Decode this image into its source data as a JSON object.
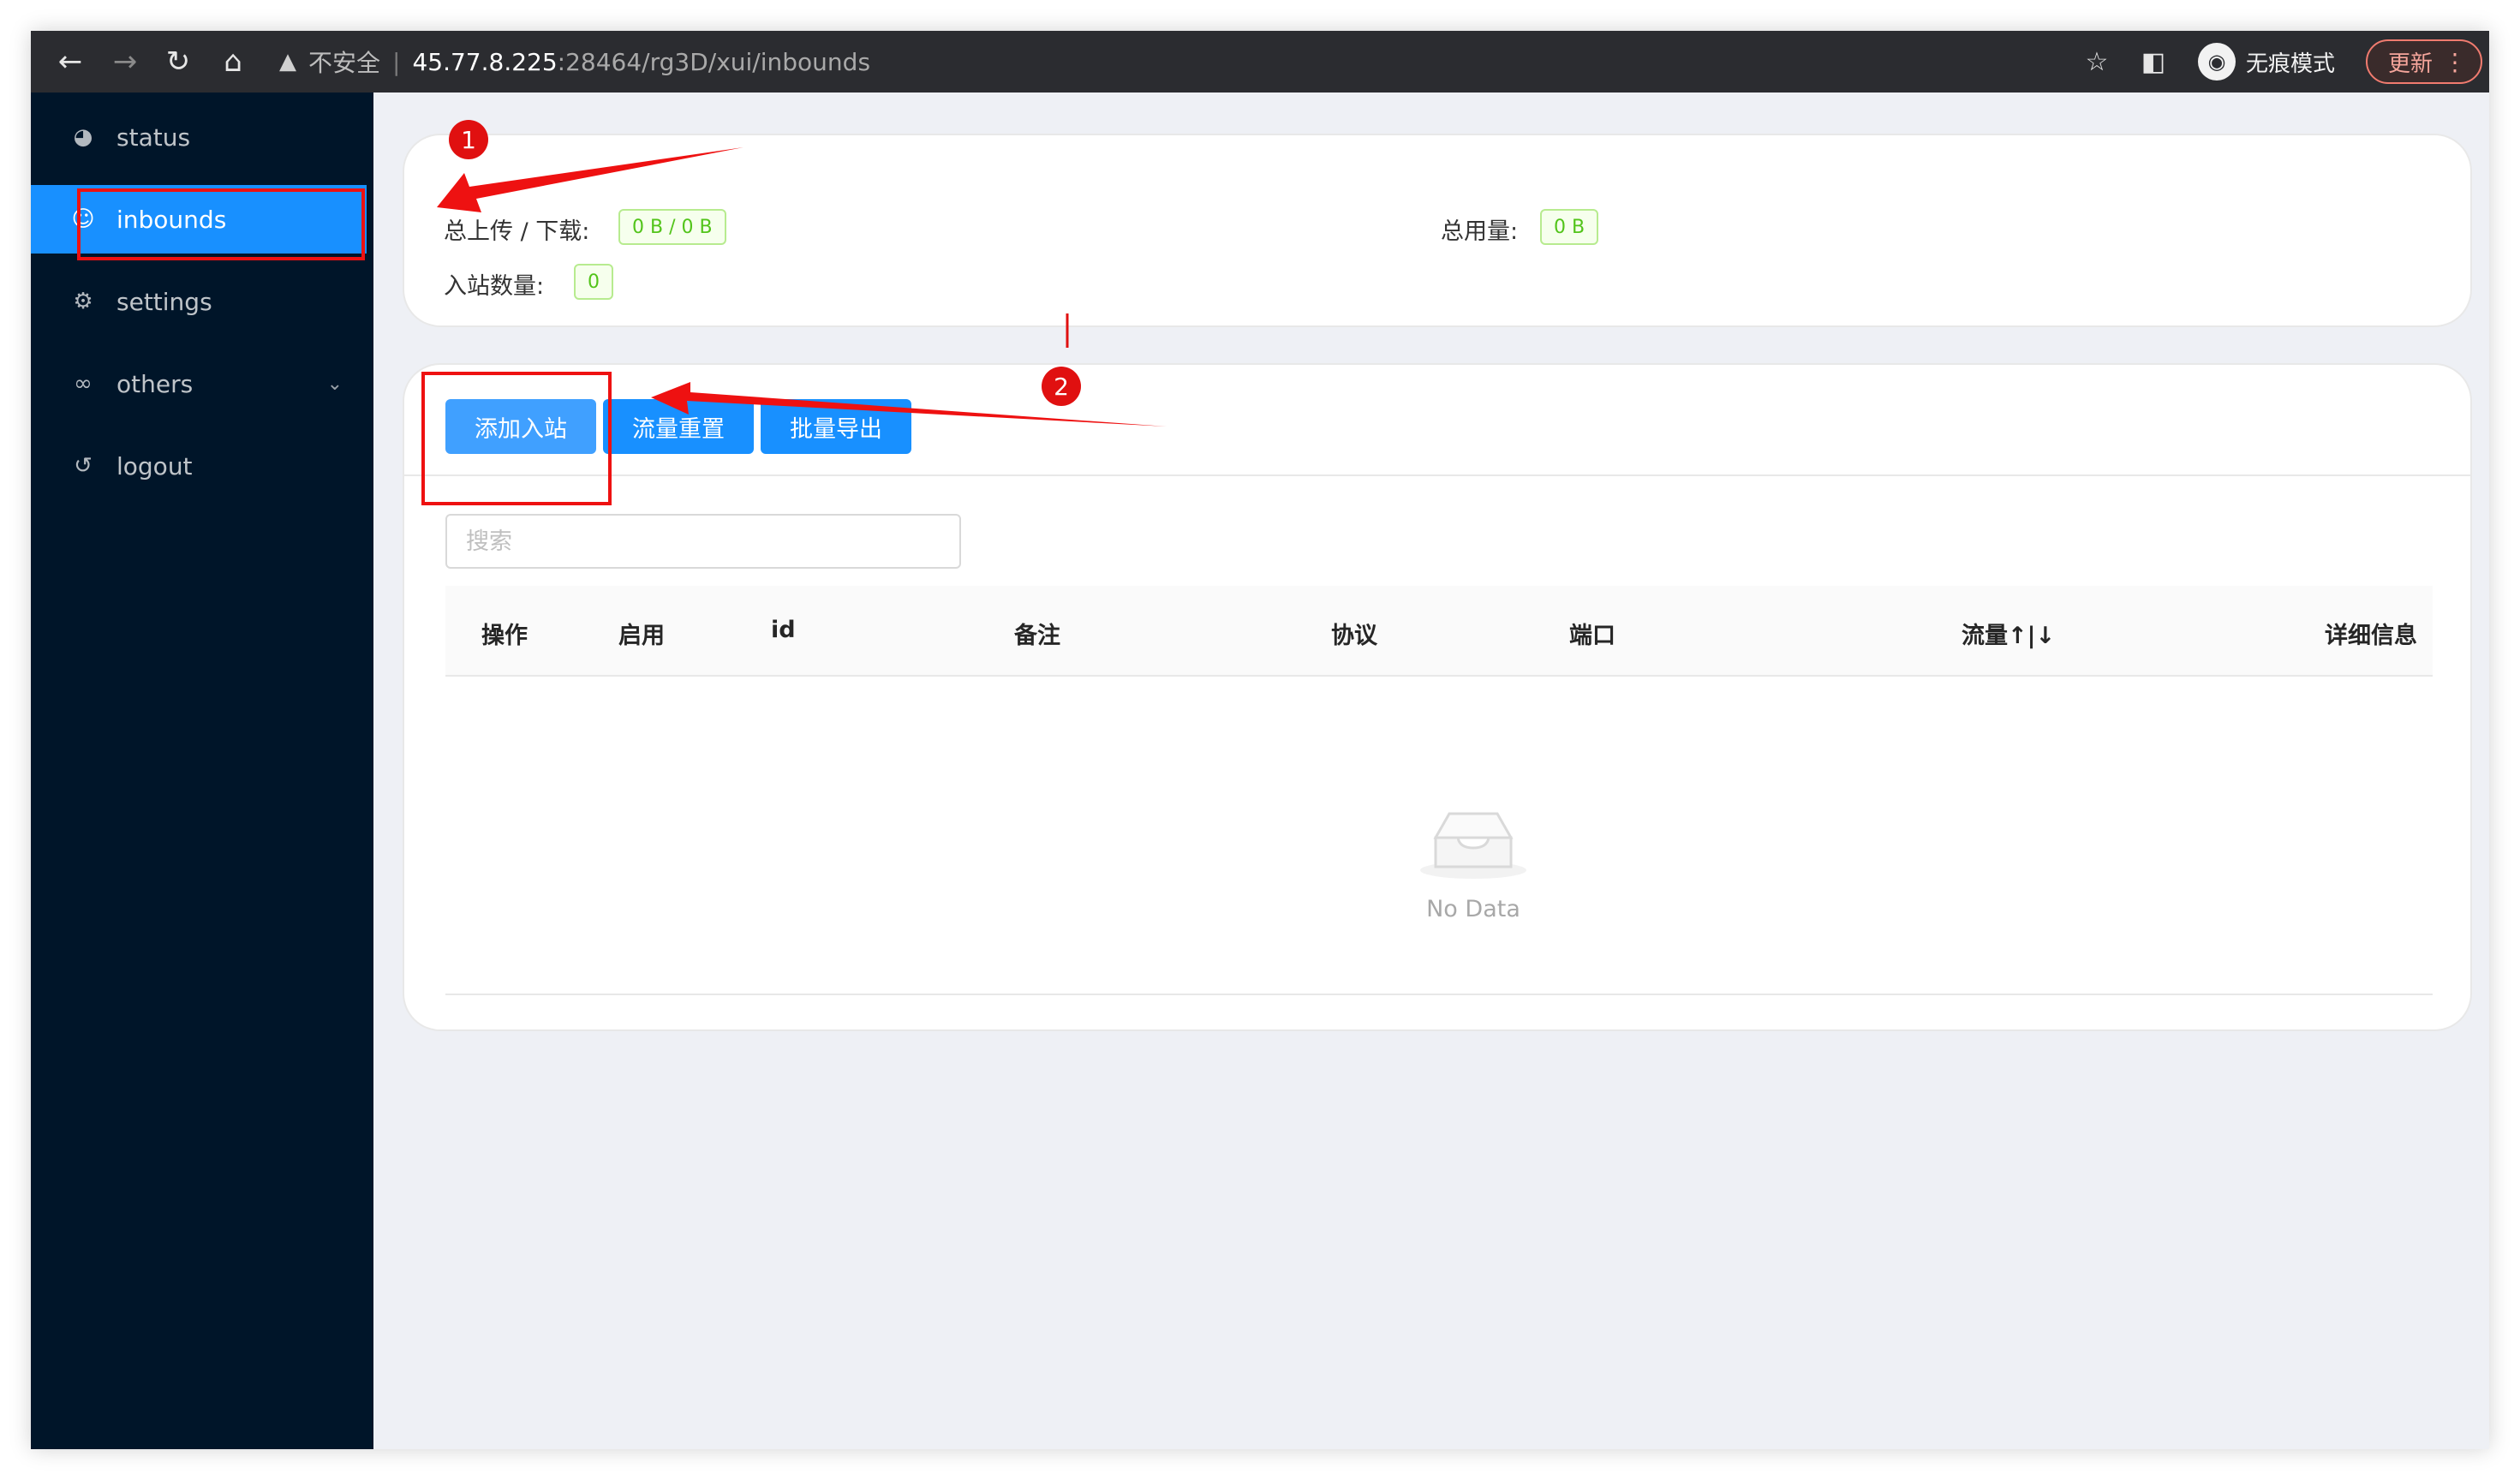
{
  "browser": {
    "warn_icon": "warning-triangle-icon",
    "insecure_label": "不安全",
    "url_host": "45.77.8.225",
    "url_path": ":28464/rg3D/xui/inbounds",
    "incognito_label": "无痕模式",
    "update_label": "更新"
  },
  "sidebar": {
    "items": [
      {
        "label": "status",
        "icon": "dashboard-icon"
      },
      {
        "label": "inbounds",
        "icon": "user-icon"
      },
      {
        "label": "settings",
        "icon": "gear-icon"
      },
      {
        "label": "others",
        "icon": "link-icon"
      },
      {
        "label": "logout",
        "icon": "logout-icon"
      }
    ]
  },
  "stats": {
    "upload_download_label": "总上传 / 下载:",
    "upload_download_value": "0 B / 0 B",
    "total_usage_label": "总用量:",
    "total_usage_value": "0 B",
    "inbound_count_label": "入站数量:",
    "inbound_count_value": "0"
  },
  "actions": {
    "add_inbound": "添加入站",
    "reset_traffic": "流量重置",
    "batch_export": "批量导出"
  },
  "search": {
    "placeholder": "搜索"
  },
  "table": {
    "headers": [
      "操作",
      "启用",
      "id",
      "备注",
      "协议",
      "端口",
      "流量↑|↓",
      "详细信息"
    ],
    "empty_text": "No Data"
  },
  "annotations": {
    "step1": "1",
    "step2": "2",
    "color": "#ee1111"
  }
}
